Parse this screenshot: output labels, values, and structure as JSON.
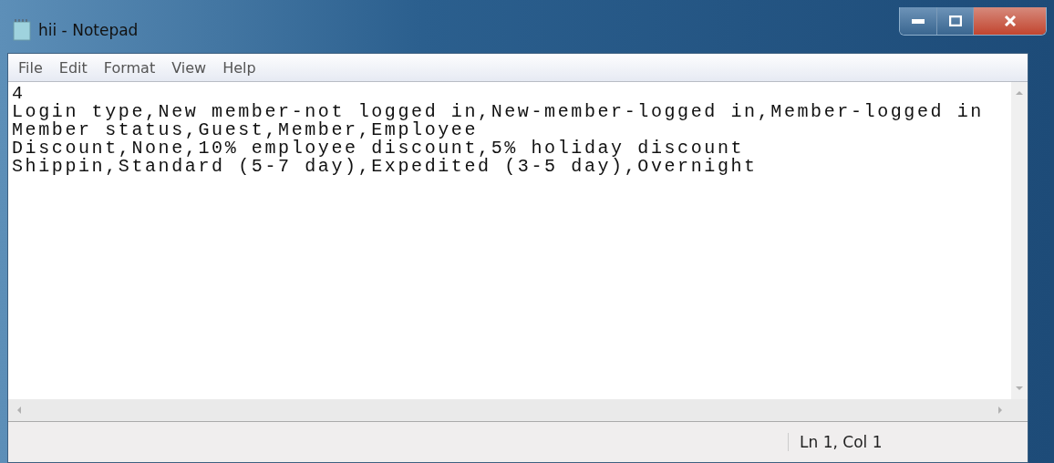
{
  "window": {
    "title": "hii - Notepad"
  },
  "menu": [
    "File",
    "Edit",
    "Format",
    "View",
    "Help"
  ],
  "editor": {
    "lines": [
      "4",
      "Login type,New member-not logged in,New-member-logged in,Member-logged in",
      "Member status,Guest,Member,Employee",
      "Discount,None,10% employee discount,5% holiday discount",
      "Shippin,Standard (5-7 day),Expedited (3-5 day),Overnight"
    ]
  },
  "status_bar": {
    "position": "Ln 1, Col 1"
  }
}
